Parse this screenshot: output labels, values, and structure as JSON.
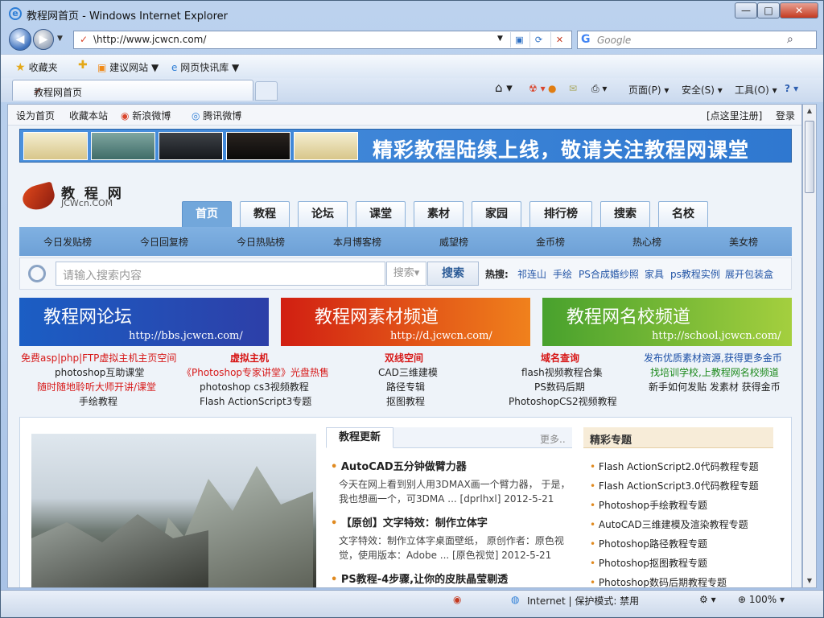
{
  "window": {
    "title": "教程网首页 - Windows Internet Explorer",
    "min": "—",
    "max": "□",
    "close": "✕"
  },
  "nav": {
    "back": "◀",
    "forward": "▶",
    "url": "\\http://www.jcwcn.com/",
    "search_placeholder": "Google"
  },
  "favorites": {
    "label": "收藏夹",
    "items": [
      "建议网站",
      "网页快讯库"
    ]
  },
  "tab": {
    "label": "教程网首页"
  },
  "commands": [
    "页面(P)",
    "安全(S)",
    "工具(O)"
  ],
  "status": {
    "zone": "Internet | 保护模式: 禁用",
    "zoom": "100%"
  },
  "page": {
    "toplinks": [
      "设为首页",
      "收藏本站",
      "新浪微博",
      "腾讯微博"
    ],
    "login": [
      "[点这里注册]",
      "登录"
    ],
    "banner_text": "精彩教程陆续上线，敬请关注教程网课堂",
    "logo_cn": "教 程 网",
    "logo_en": "JCWcn.COM",
    "tabs": [
      "首页",
      "教程",
      "论坛",
      "课堂",
      "素材",
      "家园",
      "排行榜",
      "搜索",
      "名校"
    ],
    "subnav": [
      "今日发贴榜",
      "今日回复榜",
      "今日热贴榜",
      "本月博客榜",
      "威望榜",
      "金币榜",
      "热心榜",
      "美女榜"
    ],
    "search": {
      "placeholder": "请输入搜索内容",
      "select": "搜索",
      "button": "搜索",
      "hot_label": "热搜:",
      "hot": [
        "祁连山",
        "手绘",
        "PS合成婚纱照",
        "家具",
        "ps教程实例",
        "展开包装盒"
      ]
    },
    "channels": [
      {
        "title": "教程网论坛",
        "url": "http://bbs.jcwcn.com/"
      },
      {
        "title": "教程网素材频道",
        "url": "http://d.jcwcn.com/"
      },
      {
        "title": "教程网名校频道",
        "url": "http://school.jcwcn.com/"
      }
    ],
    "links": {
      "c1": [
        "免费asp|php|FTP虚拟主机主页空间",
        "photoshop互助课堂",
        "随时随地聆听大师开讲/课堂",
        "手绘教程"
      ],
      "c2": [
        "虚拟主机",
        "《Photoshop专家讲堂》光盘热售",
        "photoshop cs3视频教程",
        "Flash ActionScript3专题"
      ],
      "c3": [
        "双线空间",
        "CAD三维建模",
        "路径专辑",
        "抠图教程"
      ],
      "c4": [
        "域名查询",
        "flash视频教程合集",
        "PS数码后期",
        "PhotoshopCS2视频教程"
      ],
      "c5": [
        "发布优质素材资源,获得更多金币",
        "找培训学校,上教程网名校频道",
        "新手如何发贴 发素材 获得金币"
      ]
    },
    "updates": {
      "title": "教程更新",
      "more": "更多..",
      "articles": [
        {
          "title": "AutoCAD五分钟做臂力器",
          "desc": "今天在网上看到别人用3DMAX画一个臂力器， 于是，我也想画一个，可3DMA ... [dprlhxl] 2012-5-21"
        },
        {
          "title": "【原创】文字特效：制作立体字",
          "desc": "文字特效：制作立体字桌面壁纸， 原创作者：原色视觉，使用版本：Adobe ... [原色视觉] 2012-5-21"
        },
        {
          "title": "PS教程-4步骤,让你的皮肤晶莹剔透",
          "desc": ""
        }
      ]
    },
    "specials": {
      "title": "精彩专题",
      "items": [
        "Flash ActionScript2.0代码教程专题",
        "Flash ActionScript3.0代码教程专题",
        "Photoshop手绘教程专题",
        "AutoCAD三维建模及渲染教程专题",
        "Photoshop路径教程专题",
        "Photoshop抠图教程专题",
        "Photoshop数码后期教程专题"
      ]
    }
  }
}
